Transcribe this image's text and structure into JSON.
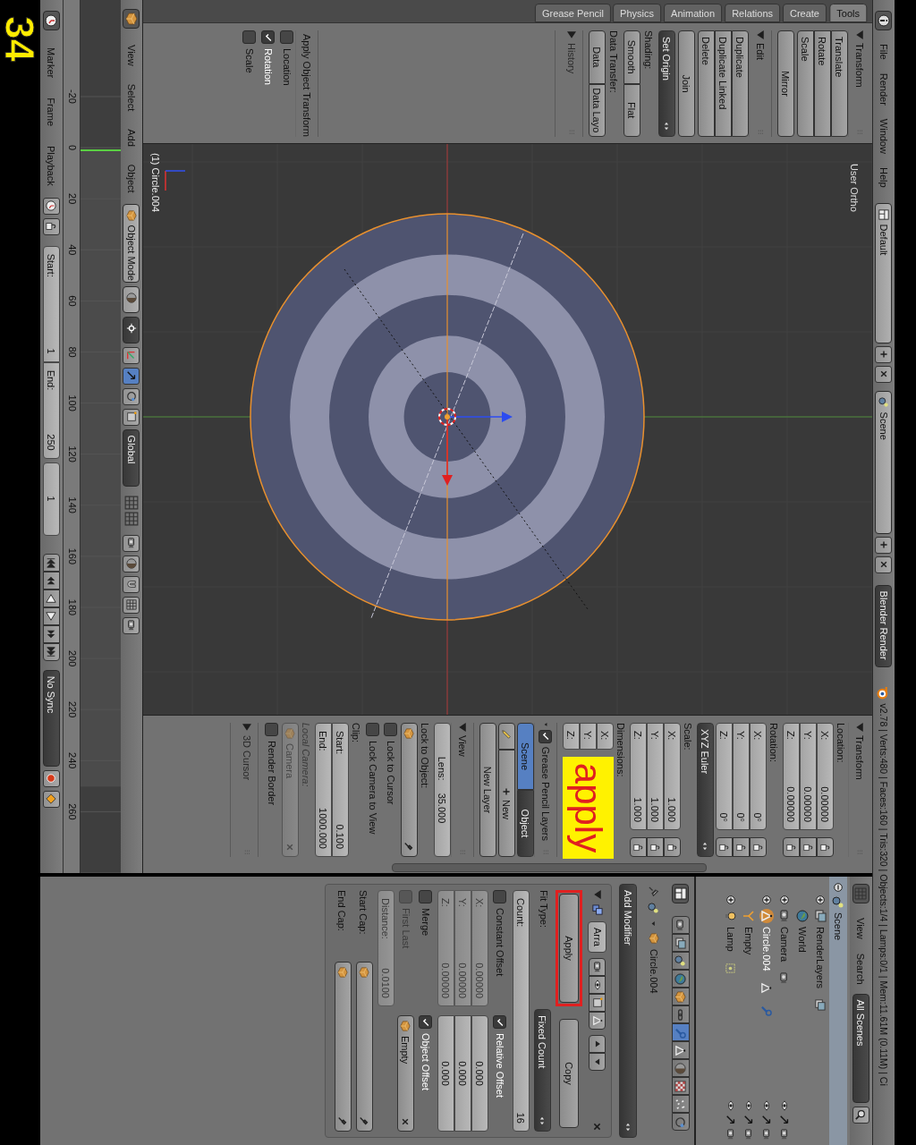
{
  "annotation_number": "34",
  "info_header": {
    "menus": [
      "File",
      "Render",
      "Window",
      "Help"
    ],
    "layout": "Default",
    "scene": "Scene",
    "engine": "Blender Render",
    "stats": "v2.78 | Verts:480 | Faces:160 | Tris:320 | Objects:1/4 | Lamps:0/1 | Mem:11.61M (0.11M) | Ci"
  },
  "tool_shelf": {
    "tabs": [
      {
        "label": "Grease Pencil",
        "selected": false
      },
      {
        "label": "Physics",
        "selected": false
      },
      {
        "label": "Animation",
        "selected": false
      },
      {
        "label": "Relations",
        "selected": false
      },
      {
        "label": "Create",
        "selected": false
      },
      {
        "label": "Tools",
        "selected": true
      }
    ],
    "panels": [
      {
        "title": "Transform",
        "expanded": true,
        "items": [
          {
            "kind": "column",
            "buttons": [
              "Translate",
              "Rotate",
              "Scale"
            ]
          },
          {
            "kind": "button",
            "label": "Mirror"
          }
        ]
      },
      {
        "title": "Edit",
        "expanded": true,
        "items": [
          {
            "kind": "column",
            "buttons": [
              "Duplicate",
              "Duplicate Linked",
              "Delete"
            ]
          },
          {
            "kind": "button",
            "label": "Join"
          },
          {
            "kind": "menu",
            "label": "Set Origin"
          },
          {
            "kind": "label",
            "label": "Shading:"
          },
          {
            "kind": "row",
            "buttons": [
              "Smooth",
              "Flat"
            ]
          },
          {
            "kind": "label",
            "label": "Data Transfer:"
          },
          {
            "kind": "row",
            "buttons": [
              "Data",
              "Data Layo"
            ]
          }
        ]
      },
      {
        "title": "History",
        "expanded": false
      }
    ],
    "operator_panel": {
      "title": "Apply Object Transform",
      "expanded": true,
      "items": [
        {
          "kind": "checkbox",
          "label": "Location",
          "checked": false
        },
        {
          "kind": "checkbox",
          "label": "Rotation",
          "checked": true
        },
        {
          "kind": "checkbox",
          "label": "Scale",
          "checked": false
        }
      ]
    }
  },
  "viewport": {
    "view_name": "User Ortho",
    "object_label": "(1) Circle.004"
  },
  "view_header": {
    "menus": [
      "View",
      "Select",
      "Add",
      "Object"
    ],
    "mode": "Object Mode",
    "orientation": "Global"
  },
  "n_panel": {
    "panels": [
      {
        "title": "Transform",
        "expanded": true,
        "items": [
          {
            "kind": "label",
            "label": "Location:"
          },
          {
            "kind": "vector",
            "locks": true,
            "fields": [
              {
                "label": "X:",
                "value": "0.00000"
              },
              {
                "label": "Y:",
                "value": "0.00000"
              },
              {
                "label": "Z:",
                "value": "0.00000"
              }
            ]
          },
          {
            "kind": "label",
            "label": "Rotation:"
          },
          {
            "kind": "vector",
            "locks": true,
            "fields": [
              {
                "label": "X:",
                "value": "0°"
              },
              {
                "label": "Y:",
                "value": "0°"
              },
              {
                "label": "Z:",
                "value": "0°"
              }
            ]
          },
          {
            "kind": "menu",
            "label": "XYZ Euler"
          },
          {
            "kind": "label",
            "label": "Scale:"
          },
          {
            "kind": "vector",
            "locks": true,
            "fields": [
              {
                "label": "X:",
                "value": "1.000"
              },
              {
                "label": "Y:",
                "value": "1.000"
              },
              {
                "label": "Z:",
                "value": "1.000"
              }
            ]
          },
          {
            "kind": "label",
            "label": "Dimensions:"
          },
          {
            "kind": "vector",
            "locks": false,
            "note": "apply",
            "fields": [
              {
                "label": "X:"
              },
              {
                "label": "Y:"
              },
              {
                "label": "Z:"
              }
            ]
          }
        ]
      },
      {
        "title": "Grease Pencil Layers",
        "expanded": true,
        "checked": true,
        "items": [
          {
            "kind": "toggle",
            "options": [
              {
                "label": "Scene",
                "selected": true
              },
              {
                "label": "Object",
                "selected": false
              }
            ]
          },
          {
            "kind": "new",
            "label": "New"
          },
          {
            "kind": "button",
            "label": "New Layer"
          }
        ]
      },
      {
        "title": "View",
        "expanded": true,
        "items": [
          {
            "kind": "number",
            "label": "Lens:",
            "value": "35.000"
          },
          {
            "kind": "label",
            "label": "Lock to Object:"
          },
          {
            "kind": "object",
            "disabled": false,
            "clear": false
          },
          {
            "kind": "checkbox",
            "label": "Lock to Cursor",
            "checked": false
          },
          {
            "kind": "checkbox",
            "label": "Lock Camera to View",
            "checked": false
          },
          {
            "kind": "label",
            "label": "Clip:"
          },
          {
            "kind": "numcol",
            "fields": [
              {
                "label": "Start:",
                "value": "0.100"
              },
              {
                "label": "End:",
                "value": "1000.000"
              }
            ]
          },
          {
            "kind": "label",
            "label": "Local Camera:",
            "disabled": true
          },
          {
            "kind": "object",
            "label": "Camera",
            "disabled": true,
            "clear": true
          },
          {
            "kind": "checkbox",
            "label": "Render Border",
            "checked": false
          }
        ]
      },
      {
        "title": "3D Cursor",
        "expanded": false
      }
    ]
  },
  "outliner": {
    "menus": [
      "View",
      "Search"
    ],
    "filter": "All Scenes",
    "tree": [
      {
        "label": "Scene",
        "kind": "scene",
        "expanded": true,
        "selected": true,
        "children": [
          {
            "label": "RenderLayers",
            "kind": "renderlayers",
            "expanded": false,
            "selected": false,
            "active": false,
            "restrict": false,
            "has_modifier": false
          },
          {
            "label": "World",
            "kind": "world",
            "selected": false,
            "active": false,
            "restrict": false,
            "has_modifier": false
          },
          {
            "label": "Camera",
            "kind": "camera",
            "expanded": false,
            "selected": false,
            "active": false,
            "restrict": true,
            "has_modifier": false
          },
          {
            "label": "Circle.004",
            "kind": "mesh",
            "expanded": false,
            "selected": false,
            "active": true,
            "restrict": true,
            "has_modifier": true
          },
          {
            "label": "Empty",
            "kind": "empty",
            "selected": false,
            "active": false,
            "restrict": true,
            "has_modifier": false
          },
          {
            "label": "Lamp",
            "kind": "lamp",
            "expanded": false,
            "selected": false,
            "active": false,
            "restrict": true,
            "has_modifier": false
          }
        ]
      }
    ]
  },
  "properties": {
    "tabs": [
      {
        "kind": "render",
        "selected": false
      },
      {
        "kind": "render_layers",
        "selected": false
      },
      {
        "kind": "scene",
        "selected": false
      },
      {
        "kind": "world",
        "selected": false
      },
      {
        "kind": "object",
        "selected": false
      },
      {
        "kind": "constraints",
        "selected": false
      },
      {
        "kind": "modifiers",
        "selected": true
      },
      {
        "kind": "data",
        "selected": false
      },
      {
        "kind": "material",
        "selected": false
      },
      {
        "kind": "texture",
        "selected": false
      },
      {
        "kind": "particles",
        "selected": false
      },
      {
        "kind": "physics",
        "selected": false
      }
    ],
    "object_name": "Circle.004",
    "add_modifier": "Add Modifier",
    "modifier": {
      "name": "Arra",
      "expanded": true,
      "buttons": [
        {
          "label": "Apply",
          "annotated": true
        },
        {
          "label": "Copy",
          "annotated": false
        }
      ],
      "fit_type_label": "Fit Type:",
      "fit_type": "Fixed Count",
      "count": {
        "label": "Count:",
        "value": "16"
      },
      "constant_offset": {
        "label": "Constant Offset",
        "checked": false,
        "fields": [
          {
            "label": "X:",
            "value": "0.00000"
          },
          {
            "label": "Y:",
            "value": "0.00000"
          },
          {
            "label": "Z:",
            "value": "0.00000"
          }
        ]
      },
      "relative_offset": {
        "label": "Relative Offset",
        "checked": true,
        "fields": [
          {
            "value": "0.000"
          },
          {
            "value": "0.000"
          },
          {
            "value": "0.000"
          }
        ]
      },
      "merge": {
        "label": "Merge",
        "checked": false
      },
      "object_offset": {
        "label": "Object Offset",
        "checked": true,
        "object": "Empty"
      },
      "first_last": {
        "label": "First Last",
        "checked": false
      },
      "distance": {
        "label": "Distance:",
        "value": "0.0100"
      },
      "start_cap": "Start Cap:",
      "end_cap": "End Cap:"
    }
  },
  "timeline": {
    "frames": [
      "-20",
      "0",
      "20",
      "40",
      "60",
      "80",
      "100",
      "120",
      "140",
      "160",
      "180",
      "200",
      "220",
      "240",
      "260"
    ],
    "menus": [
      "Marker",
      "Frame",
      "Playback"
    ],
    "start": {
      "label": "Start:",
      "value": "1"
    },
    "end": {
      "label": "End:",
      "value": "250"
    },
    "current": "1",
    "sync": "No Sync"
  }
}
